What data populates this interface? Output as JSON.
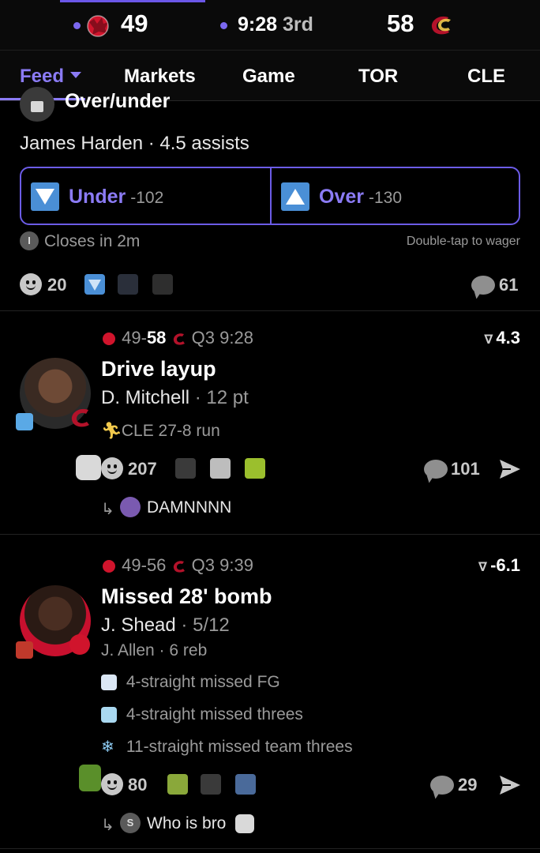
{
  "scoreboard": {
    "away_score": "49",
    "home_score": "58",
    "clock": "9:28",
    "period": "3rd",
    "away_team_icon": "raptors-logo",
    "home_team_icon": "cavaliers-logo"
  },
  "tabs": [
    {
      "label": "Feed",
      "active": true
    },
    {
      "label": "Markets"
    },
    {
      "label": "Game"
    },
    {
      "label": "TOR"
    },
    {
      "label": "CLE"
    }
  ],
  "market": {
    "type": "Over/under",
    "title": "James Harden · 4.5 assists",
    "under": {
      "label": "Under",
      "odds": "-102"
    },
    "over": {
      "label": "Over",
      "odds": "-130"
    },
    "closes": "Closes in 2m",
    "hint": "Double-tap to wager",
    "reactions": "20",
    "comments": "61"
  },
  "plays": [
    {
      "score_away": "49",
      "score_home": "58",
      "quarter_clock": "Q3 9:28",
      "win_prob": "4.3",
      "title": "Drive layup",
      "player": "D. Mitchell",
      "stat": "12 pt",
      "notes": [
        "CLE 27-8 run"
      ],
      "reactions": "207",
      "comments": "101",
      "reply": "DAMNNNN"
    },
    {
      "score_away": "49",
      "score_home": "56",
      "quarter_clock": "Q3 9:39",
      "win_prob": "-6.1",
      "title": "Missed 28' bomb",
      "player": "J. Shead",
      "stat": "5/12",
      "assist": "J. Allen",
      "assist_stat": "6 reb",
      "notes": [
        "4-straight missed FG",
        "4-straight missed threes",
        "11-straight missed team threes"
      ],
      "reactions": "80",
      "comments": "29",
      "reply_initial": "S",
      "reply": "Who is bro"
    }
  ],
  "colors": {
    "accent": "#8b7bf5",
    "under_over_icon": "#4a8fd6",
    "background": "#000000"
  }
}
